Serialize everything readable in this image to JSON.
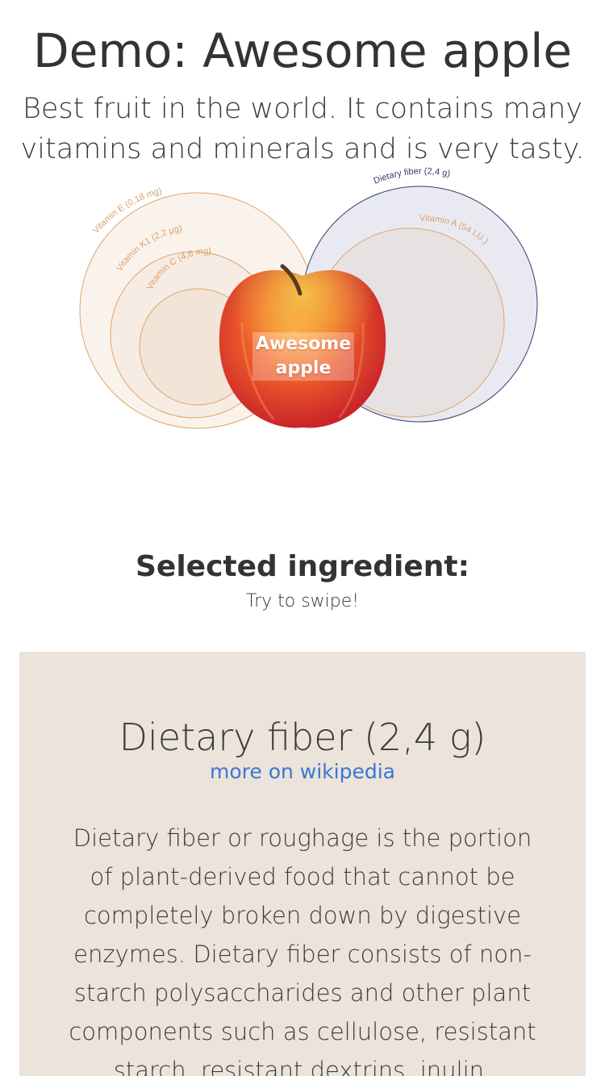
{
  "header": {
    "title": "Demo: Awesome apple",
    "subtitle": "Best fruit in the world. It contains many vitamins and minerals and is very tasty."
  },
  "chart": {
    "center_label": "Awesome apple",
    "center_image": "apple-photo",
    "rings": [
      {
        "label": "Vitamin E (0,18 mg)",
        "group": "vitamins-left",
        "color": "#d9a066"
      },
      {
        "label": "Vitamin K1 (2,2 µg)",
        "group": "vitamins-left",
        "color": "#d9a066"
      },
      {
        "label": "Vitamin C (4,6 mg)",
        "group": "vitamins-left",
        "color": "#d9a066"
      },
      {
        "label": "Dietary fiber (2,4 g)",
        "group": "right",
        "color": "#33406e"
      },
      {
        "label": "Vitamin A (54 I.U.)",
        "group": "right",
        "color": "#d9a066"
      }
    ]
  },
  "selection": {
    "heading": "Selected ingredient:",
    "hint": "Try to swipe!"
  },
  "card": {
    "title": "Dietary fiber (2,4 g)",
    "link_label": "more on wikipedia",
    "description": "Dietary fiber or roughage is the portion of plant-derived food that cannot be completely broken down by digestive enzymes. Dietary fiber consists of non-starch polysaccharides and other plant components such as cellulose, resistant starch, resistant dextrins, inulin, lignins,",
    "background": "#ece3da"
  },
  "colors": {
    "accent_link": "#3a76d8",
    "ring_orange": "#d9a066",
    "ring_navy": "#33406e"
  }
}
